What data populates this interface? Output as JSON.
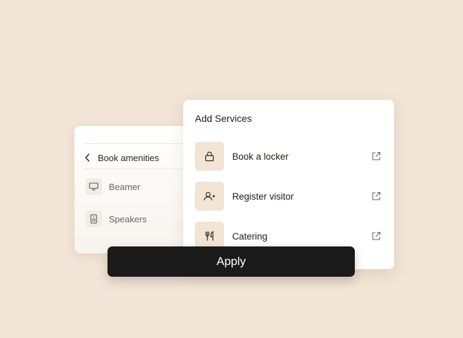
{
  "amenities_panel": {
    "title": "Book amenities",
    "items": [
      {
        "label": "Beamer",
        "icon": "monitor-icon"
      },
      {
        "label": "Speakers",
        "icon": "speaker-icon"
      }
    ]
  },
  "services_card": {
    "title": "Add Services",
    "items": [
      {
        "label": "Book a locker",
        "icon": "lock-icon"
      },
      {
        "label": "Register visitor",
        "icon": "user-add-icon"
      },
      {
        "label": "Catering",
        "icon": "cutlery-icon"
      }
    ]
  },
  "apply_button": {
    "label": "Apply"
  },
  "colors": {
    "background": "#f2e4d6",
    "icon_tile": "#f3e4d5",
    "button": "#1b1a1a"
  }
}
